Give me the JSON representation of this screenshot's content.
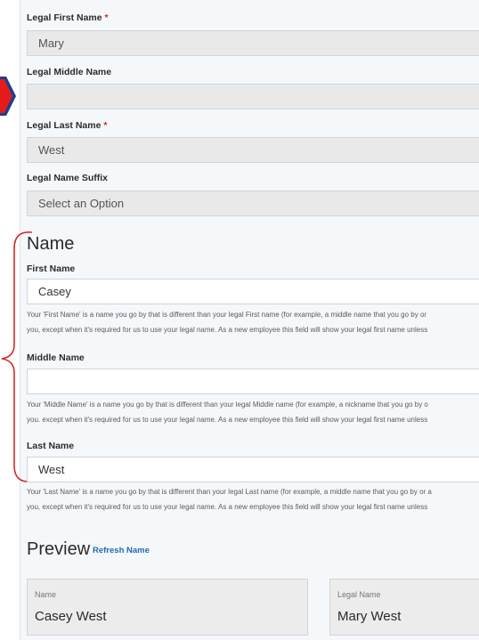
{
  "legal": {
    "first_label": "Legal First Name",
    "first_value": "Mary",
    "middle_label": "Legal Middle Name",
    "middle_value": "",
    "last_label": "Legal Last Name",
    "last_value": "West",
    "suffix_label": "Legal Name Suffix",
    "suffix_value": "Select an Option",
    "required_marker": "*"
  },
  "name_section": {
    "title": "Name",
    "first_label": "First Name",
    "first_value": "Casey",
    "first_help_1": "Your 'First Name' is a name you go by that is different than your legal First name (for example, a middle name that you go by or",
    "first_help_2": "you, except when it's required for us to use your legal name. As a new employee this field will show your legal first name unless",
    "middle_label": "Middle Name",
    "middle_value": "",
    "middle_help_1": "Your 'Middle Name' is a name you go by that is different than your legal Middle name (for example, a nickname that you go by o",
    "middle_help_2": "you. except when it's required for us to use your legal name. As a new employee this field will show your legal first name unless",
    "last_label": "Last Name",
    "last_value": "West",
    "last_help_1": "Your 'Last Name' is a name you go by that is different than your legal Last name (for example, a middle name that you go by or a",
    "last_help_2": "you, except when it's required for us to use your legal name. As a new employee this field will show your legal first name unless"
  },
  "preview": {
    "title": "Preview",
    "refresh_label": "Refresh Name",
    "name_caption": "Name",
    "name_value": "Casey West",
    "legal_caption": "Legal Name",
    "legal_value": "Mary West"
  },
  "annotations": {
    "bracket_color": "#d42a2a",
    "marker_color": "#e51b1b",
    "marker_border": "#1e3f8a"
  }
}
